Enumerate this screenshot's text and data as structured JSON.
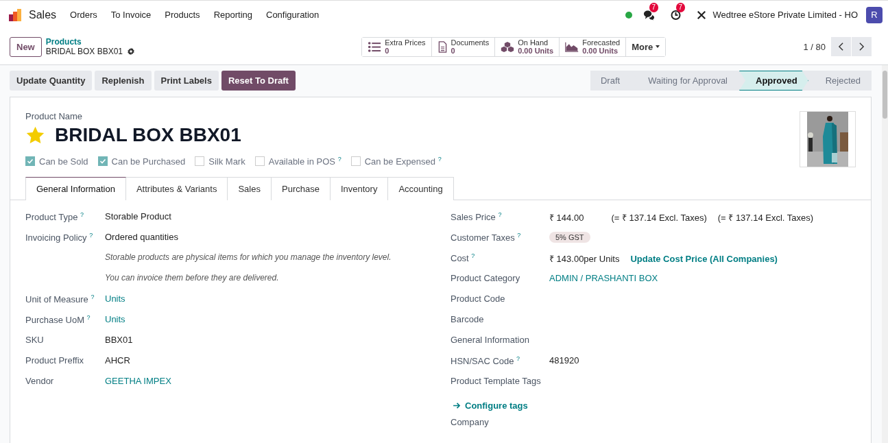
{
  "navbar": {
    "app": "Sales",
    "menu": [
      "Orders",
      "To Invoice",
      "Products",
      "Reporting",
      "Configuration"
    ],
    "online": true,
    "messages_badge": "7",
    "activities_badge": "7",
    "company": "Wedtree eStore Private Limited - HO",
    "avatar": "R"
  },
  "control_panel": {
    "new_button": "New",
    "breadcrumb": "Products",
    "record": "BRIDAL BOX BBX01",
    "stat_buttons": [
      {
        "label": "Extra Prices",
        "value": "0"
      },
      {
        "label": "Documents",
        "value": "0"
      },
      {
        "label": "On Hand",
        "value": "0.00 Units"
      },
      {
        "label": "Forecasted",
        "value": "0.00 Units"
      }
    ],
    "more": "More",
    "pager": "1 / 80"
  },
  "actions": [
    {
      "label": "Update Quantity",
      "primary": false
    },
    {
      "label": "Replenish",
      "primary": false
    },
    {
      "label": "Print Labels",
      "primary": false
    },
    {
      "label": "Reset To Draft",
      "primary": true
    }
  ],
  "stages": [
    {
      "label": "Draft",
      "selected": false
    },
    {
      "label": "Waiting for Approval",
      "selected": false
    },
    {
      "label": "Approved",
      "selected": true
    },
    {
      "label": "Rejected",
      "selected": false
    }
  ],
  "product": {
    "name_label": "Product Name",
    "name": "BRIDAL BOX BBX01",
    "favorite": true,
    "options": [
      {
        "label": "Can be Sold",
        "checked": true
      },
      {
        "label": "Can be Purchased",
        "checked": true
      },
      {
        "label": "Silk Mark",
        "checked": false
      },
      {
        "label": "Available in POS $^{?}$",
        "checked": false
      },
      {
        "label": "Can be Expensed $^{?}$",
        "checked": false
      }
    ]
  },
  "tabs": [
    {
      "label": "General Information",
      "selected": true
    },
    {
      "label": "Attributes & Variants",
      "selected": false
    },
    {
      "label": "Sales",
      "selected": false
    },
    {
      "label": "Purchase",
      "selected": false
    },
    {
      "label": "Inventory",
      "selected": false
    },
    {
      "label": "Accounting",
      "selected": false
    }
  ],
  "left_fields": [
    {
      "label": "Product Type $^{?}$",
      "values": [
        {
          "kind": "text",
          "text": "Storable Product"
        }
      ]
    },
    {
      "label": "Invoicing Policy $^{?}$",
      "values": [
        {
          "kind": "text",
          "text": "Ordered quantities"
        }
      ]
    },
    {
      "values": [
        {
          "kind": "note",
          "text": "Storable products are physical items for which you manage the inventory level."
        }
      ]
    },
    {
      "values": [
        {
          "kind": "note",
          "text": "You can invoice them before they are delivered."
        }
      ]
    },
    {
      "label": "Unit of Measure $^{?}$",
      "values": [
        {
          "kind": "link",
          "text": "Units"
        }
      ]
    },
    {
      "label": "Purchase UoM $^{?}$",
      "values": [
        {
          "kind": "link",
          "text": "Units"
        }
      ]
    },
    {
      "label": "SKU",
      "values": [
        {
          "kind": "text",
          "text": "BBX01"
        }
      ]
    },
    {
      "label": "Product Preffix",
      "values": [
        {
          "kind": "text",
          "text": "AHCR"
        }
      ]
    },
    {
      "label": "Vendor",
      "values": [
        {
          "kind": "link",
          "text": "GEETHA IMPEX"
        }
      ]
    }
  ],
  "right_fields": [
    {
      "label": "Sales Price $^{?}$",
      "values": [
        {
          "kind": "text",
          "text": "₹ 144.00"
        },
        {
          "kind": "aside",
          "text": "(= ₹ 137.14 Excl. Taxes)"
        },
        {
          "kind": "aside",
          "text": "(= ₹ 137.14 Excl. Taxes)"
        }
      ]
    },
    {
      "label": "Customer Taxes $^{?}$",
      "values": [
        {
          "kind": "tag",
          "text": "5% GST"
        }
      ]
    },
    {
      "label": "Cost $^{?}$",
      "values": [
        {
          "kind": "text",
          "text": "₹ 143.00per Units"
        },
        {
          "kind": "button",
          "text": "Update Cost Price (All Companies)"
        }
      ]
    },
    {
      "label": "Product Category",
      "values": [
        {
          "kind": "link",
          "text": "ADMIN / PRASHANTI BOX"
        }
      ]
    },
    {
      "label": "Product Code"
    },
    {
      "label": "Barcode"
    },
    {
      "label": "General Information"
    },
    {
      "label": "HSN/SAC Code $^{?}$",
      "values": [
        {
          "kind": "text",
          "text": "481920"
        }
      ]
    },
    {
      "label": "Product Template Tags"
    },
    {
      "values": [
        {
          "kind": "action",
          "text": "Configure tags"
        }
      ]
    },
    {
      "label": "Company"
    }
  ]
}
